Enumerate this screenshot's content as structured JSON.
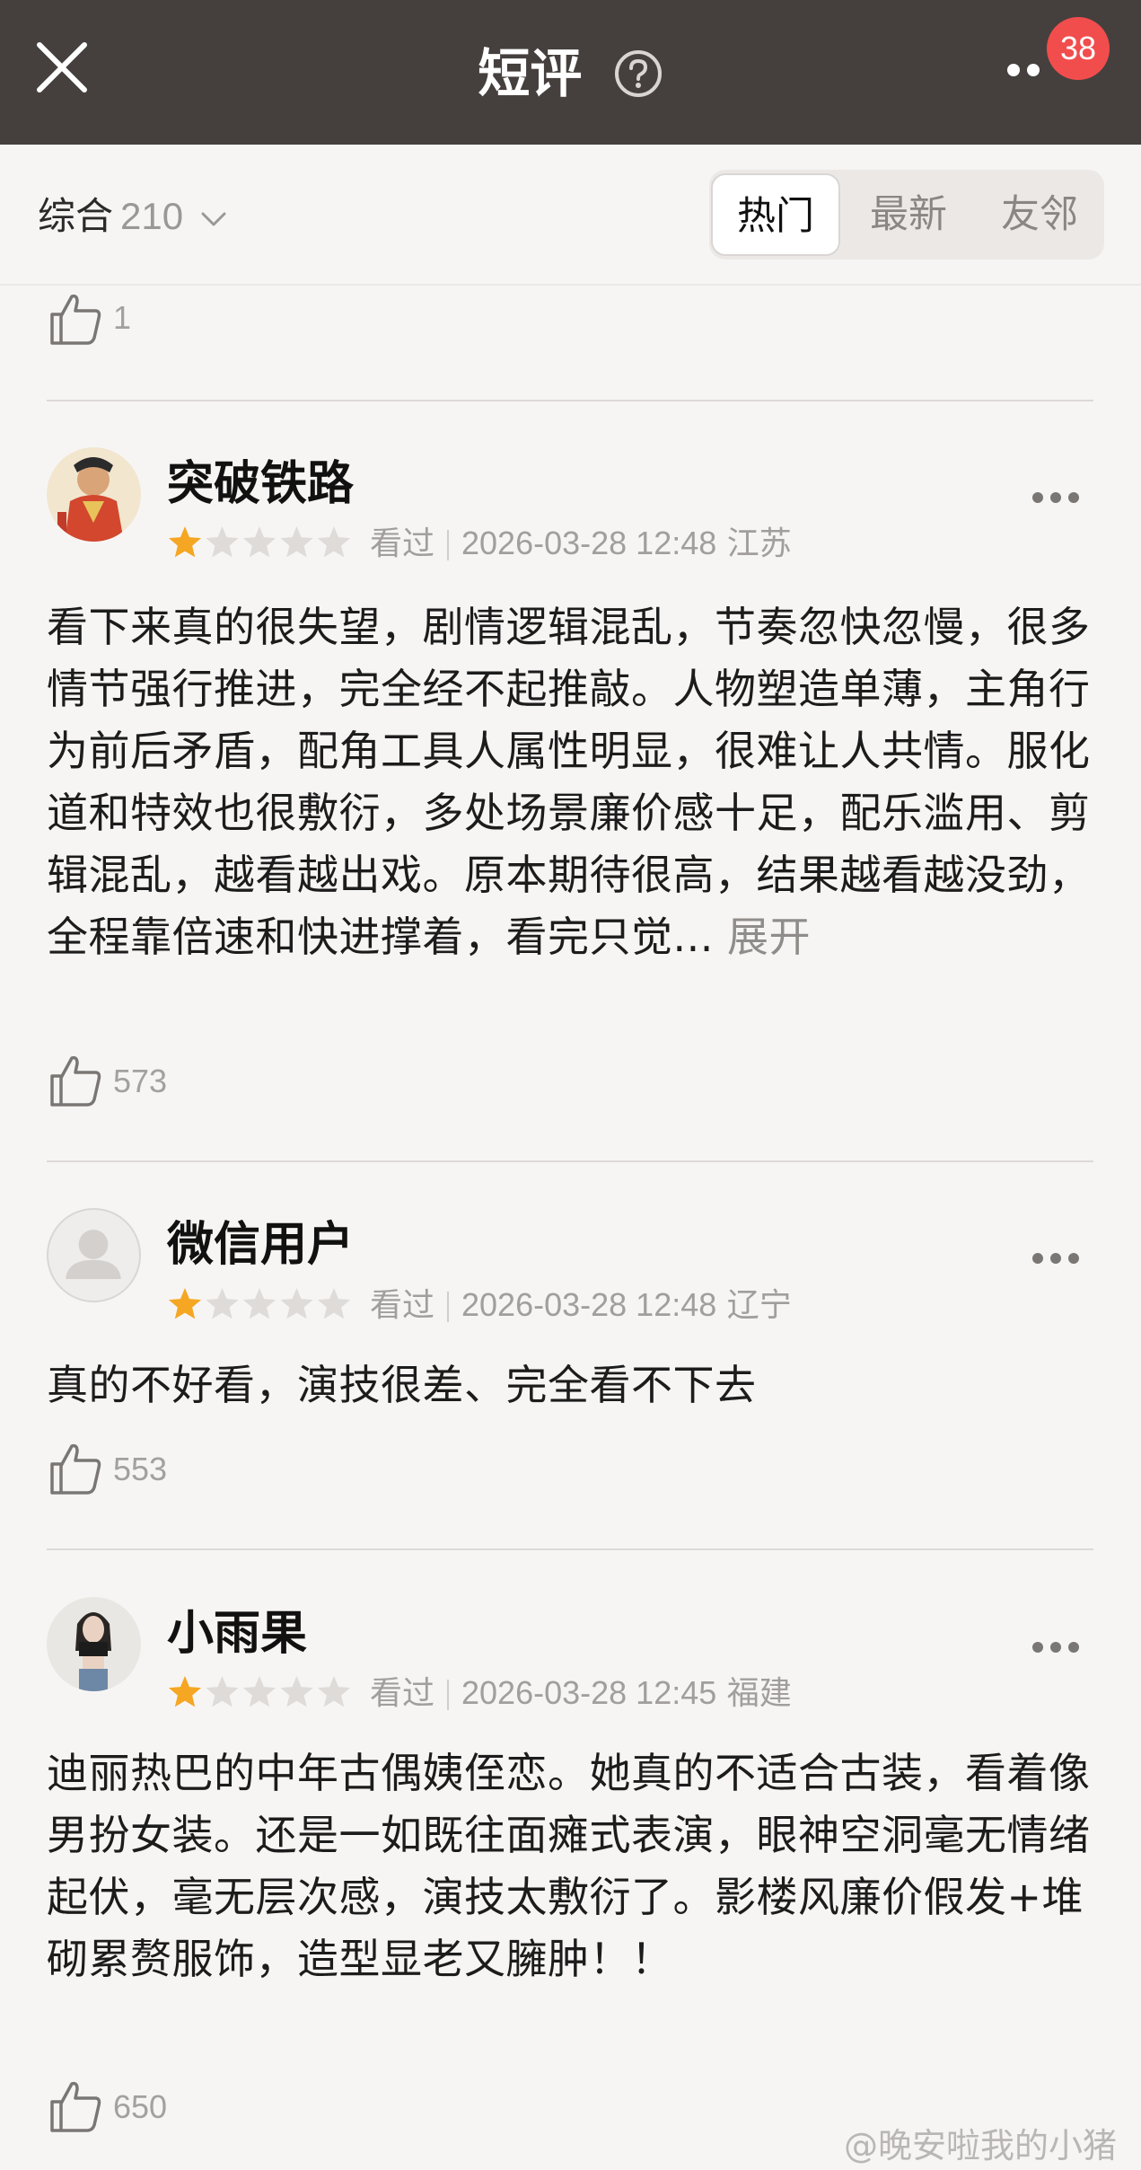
{
  "header": {
    "title": "短评",
    "badge_count": "38"
  },
  "filter": {
    "sort_label": "综合",
    "count": "210",
    "tabs": [
      {
        "label": "热门",
        "active": true
      },
      {
        "label": "最新",
        "active": false
      },
      {
        "label": "友邻",
        "active": false
      }
    ]
  },
  "top_partial": {
    "likes": "1"
  },
  "reviews": [
    {
      "username": "突破铁路",
      "rating": 1,
      "status": "看过",
      "datetime": "2026-03-28 12:48",
      "location": "江苏",
      "text": "看下来真的很失望，剧情逻辑混乱，节奏忽快忽慢，很多情节强行推进，完全经不起推敲。人物塑造单薄，主角行为前后矛盾，配角工具人属性明显，很难让人共情。服化道和特效也很敷衍，多处场景廉价感十足，配乐滥用、剪辑混乱，越看越出戏。原本期待很高，结果越看越没劲，全程靠倍速和快进撑着，看完只觉...",
      "expand_label": "展开",
      "likes": "573"
    },
    {
      "username": "微信用户",
      "rating": 1,
      "status": "看过",
      "datetime": "2026-03-28 12:48",
      "location": "辽宁",
      "text": "真的不好看，演技很差、完全看不下去",
      "likes": "553"
    },
    {
      "username": "小雨果",
      "rating": 1,
      "status": "看过",
      "datetime": "2026-03-28 12:45",
      "location": "福建",
      "text": "迪丽热巴的中年古偶姨侄恋。她真的不适合古装，看着像男扮女装。还是一如既往面瘫式表演，眼神空洞毫无情绪起伏，毫无层次感，演技太敷衍了。影楼风廉价假发+堆砌累赘服饰，造型显老又臃肿！！",
      "likes": "650"
    }
  ],
  "watermark": "@晚安啦我的小猪",
  "colors": {
    "titlebar": "#45403e",
    "badge": "#f24d4d",
    "star_filled": "#f5a623",
    "star_empty": "#dedbd9"
  }
}
